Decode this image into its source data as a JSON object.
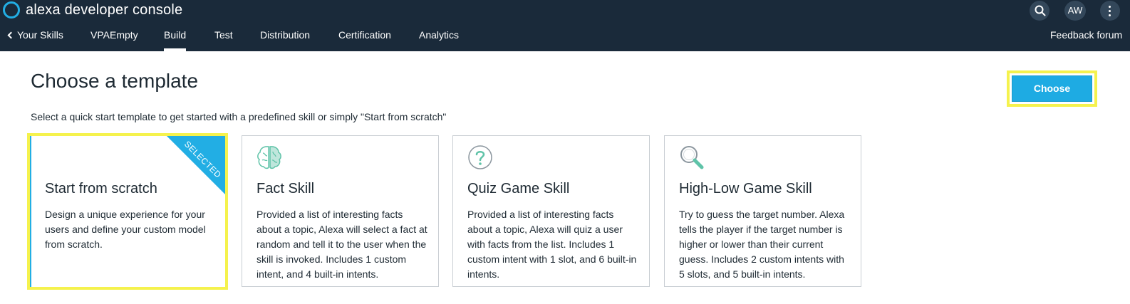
{
  "header": {
    "app_title": "alexa developer console",
    "avatar_initials": "AW",
    "nav": {
      "back_label": "Your Skills",
      "items": [
        "VPAEmpty",
        "Build",
        "Test",
        "Distribution",
        "Certification",
        "Analytics"
      ],
      "active": "Build",
      "feedback_label": "Feedback forum"
    }
  },
  "main": {
    "title": "Choose a template",
    "subtitle": "Select a quick start template to get started with a predefined skill or simply \"Start from scratch\"",
    "choose_button": "Choose",
    "cards": [
      {
        "title": "Start from scratch",
        "description": "Design a unique experience for your users and define your custom model from scratch.",
        "selected": true,
        "badge": "SELECTED",
        "icon": null
      },
      {
        "title": "Fact Skill",
        "description": "Provided a list of interesting facts about a topic, Alexa will select a fact at random and tell it to the user when the skill is invoked. Includes 1 custom intent, and 4 built-in intents.",
        "selected": false,
        "icon": "brain-icon"
      },
      {
        "title": "Quiz Game Skill",
        "description": "Provided a list of interesting facts about a topic, Alexa will quiz a user with facts from the list. Includes 1 custom intent with 1 slot, and 6 built-in intents.",
        "selected": false,
        "icon": "question-icon"
      },
      {
        "title": "High-Low Game Skill",
        "description": "Try to guess the target number. Alexa tells the player if the target number is higher or lower than their current guess. Includes 2 custom intents with 5 slots, and 5 built-in intents.",
        "selected": false,
        "icon": "magnifier-icon"
      }
    ]
  },
  "colors": {
    "header_bg": "#1a2a3a",
    "accent": "#1eabe3",
    "highlight": "#f5f24d",
    "icon_teal": "#5fc3a8"
  }
}
